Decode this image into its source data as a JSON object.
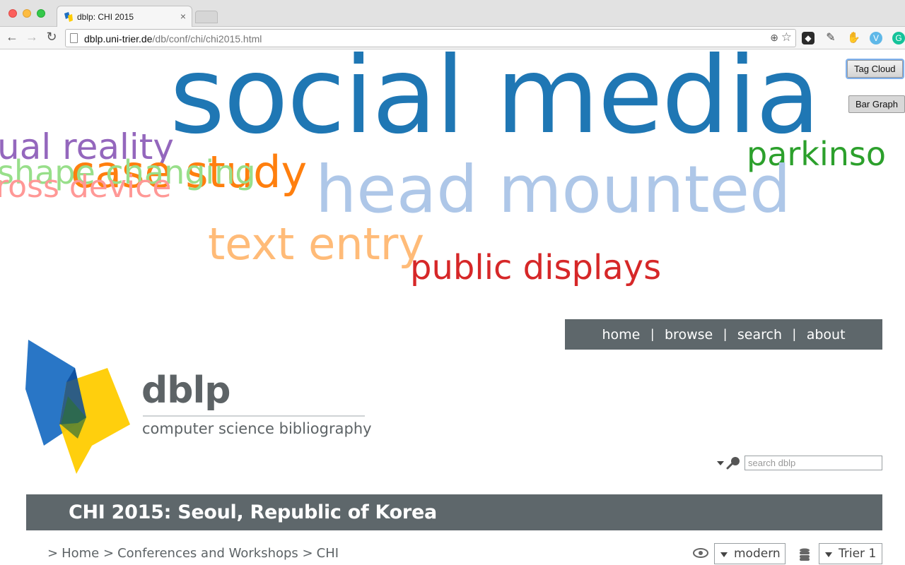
{
  "browser": {
    "tab_title": "dblp: CHI 2015",
    "url_host": "dblp.uni-trier.de",
    "url_path": "/db/conf/chi/chi2015.html",
    "tab_close": "×"
  },
  "tag_cloud": {
    "words": [
      {
        "text": "social media",
        "color": "#1f77b4"
      },
      {
        "text": "parkinso",
        "color": "#2ca02c"
      },
      {
        "text": "ual reality",
        "color": "#9467bd"
      },
      {
        "text": "case study",
        "color": "#ff7f0e"
      },
      {
        "text": "shape changing",
        "color": "#98df8a"
      },
      {
        "text": "ross device",
        "color": "#ff9896"
      },
      {
        "text": "head mounted",
        "color": "#aec7e8"
      },
      {
        "text": "text entry",
        "color": "#ffbb78"
      },
      {
        "text": "public displays",
        "color": "#d62728"
      }
    ]
  },
  "view_buttons": {
    "tag_cloud": "Tag Cloud",
    "bar_graph": "Bar Graph"
  },
  "nav": {
    "home": "home",
    "browse": "browse",
    "search": "search",
    "about": "about",
    "separator": "|"
  },
  "logo": {
    "wordmark": "dblp",
    "tagline": "computer science bibliography"
  },
  "search": {
    "placeholder": "search dblp"
  },
  "page_title": "CHI 2015: Seoul, Republic of Korea",
  "breadcrumb": {
    "marker": ">",
    "items": [
      "Home",
      "Conferences and Workshops",
      "CHI"
    ]
  },
  "settings": {
    "style_value": "modern",
    "mirror_value": "Trier 1"
  },
  "colors": {
    "nav_bg": "#5e676b",
    "logo_blue": "#1e6fc3",
    "logo_yellow": "#ffcc00"
  }
}
